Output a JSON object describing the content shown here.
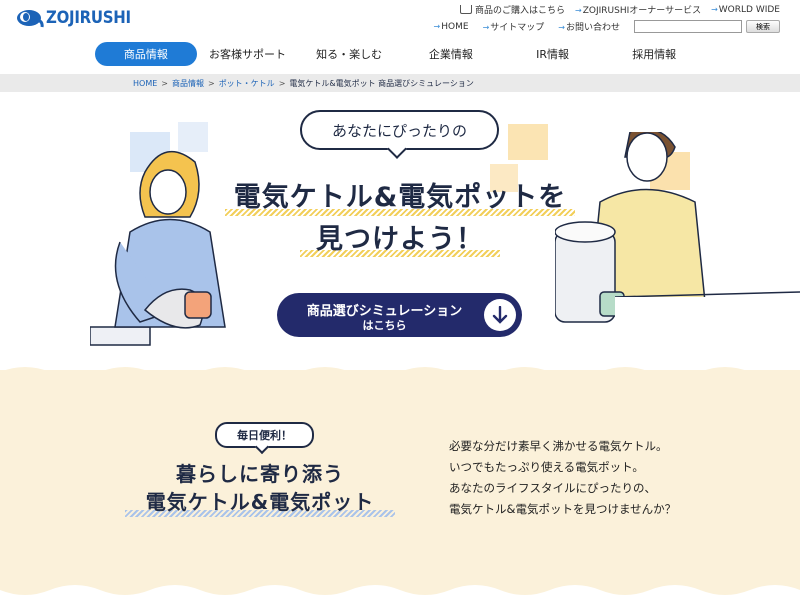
{
  "brand": {
    "logo_text": "ZOJIRUSHI"
  },
  "utility": {
    "cart_label": "商品のご購入はこちら",
    "links": [
      "ZOJIRUSHIオーナーサービス",
      "WORLD WIDE"
    ],
    "sub_links": [
      "HOME",
      "サイトマップ",
      "お問い合わせ"
    ],
    "search_placeholder": "",
    "search_button": "検索"
  },
  "nav": {
    "items": [
      "商品情報",
      "お客様サポート",
      "知る・楽しむ",
      "企業情報",
      "IR情報",
      "採用情報"
    ],
    "active_index": 0
  },
  "breadcrumb": [
    "HOME",
    "商品情報",
    "ポット・ケトル",
    "電気ケトル&電気ポット 商品選びシミュレーション"
  ],
  "hero": {
    "bubble": "あなたにぴったりの",
    "title_line1": "電気ケトル&電気ポットを",
    "title_line2": "見つけよう！",
    "cta_line1": "商品選びシミュレーション",
    "cta_line2": "はこちら"
  },
  "section": {
    "tag": "毎日便利！",
    "title_line1": "暮らしに寄り添う",
    "title_line2": "電気ケトル&電気ポット",
    "description": [
      "必要な分だけ素早く沸かせる電気ケトル。",
      "いつでもたっぷり使える電気ポット。",
      "あなたのライフスタイルにぴったりの、",
      "電気ケトル&電気ポットを見つけませんか？"
    ]
  },
  "colors": {
    "brand_blue": "#1c63b7",
    "nav_active": "#1f7bd6",
    "cta_navy": "#232a6b",
    "cream": "#fbf1da",
    "ink": "#1f2a44"
  }
}
